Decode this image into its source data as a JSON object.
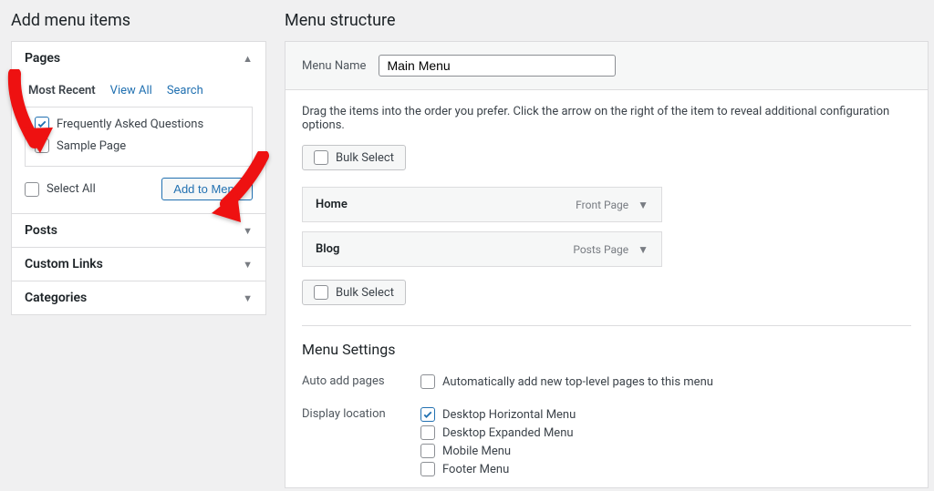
{
  "left": {
    "title": "Add menu items",
    "panels": {
      "pages": {
        "label": "Pages",
        "tabs": {
          "recent": "Most Recent",
          "all": "View All",
          "search": "Search"
        },
        "items": [
          {
            "label": "Frequently Asked Questions",
            "checked": true
          },
          {
            "label": "Sample Page",
            "checked": false
          }
        ],
        "select_all": "Select All",
        "add_button": "Add to Menu"
      },
      "posts": "Posts",
      "custom_links": "Custom Links",
      "categories": "Categories"
    }
  },
  "right": {
    "title": "Menu structure",
    "name_label": "Menu Name",
    "name_value": "Main Menu",
    "hint": "Drag the items into the order you prefer. Click the arrow on the right of the item to reveal additional configuration options.",
    "bulk": "Bulk Select",
    "items": [
      {
        "label": "Home",
        "type": "Front Page"
      },
      {
        "label": "Blog",
        "type": "Posts Page"
      }
    ],
    "settings": {
      "title": "Menu Settings",
      "auto_label": "Auto add pages",
      "auto_option": "Automatically add new top-level pages to this menu",
      "display_label": "Display location",
      "locations": [
        {
          "label": "Desktop Horizontal Menu",
          "checked": true
        },
        {
          "label": "Desktop Expanded Menu",
          "checked": false
        },
        {
          "label": "Mobile Menu",
          "checked": false
        },
        {
          "label": "Footer Menu",
          "checked": false
        }
      ]
    }
  }
}
